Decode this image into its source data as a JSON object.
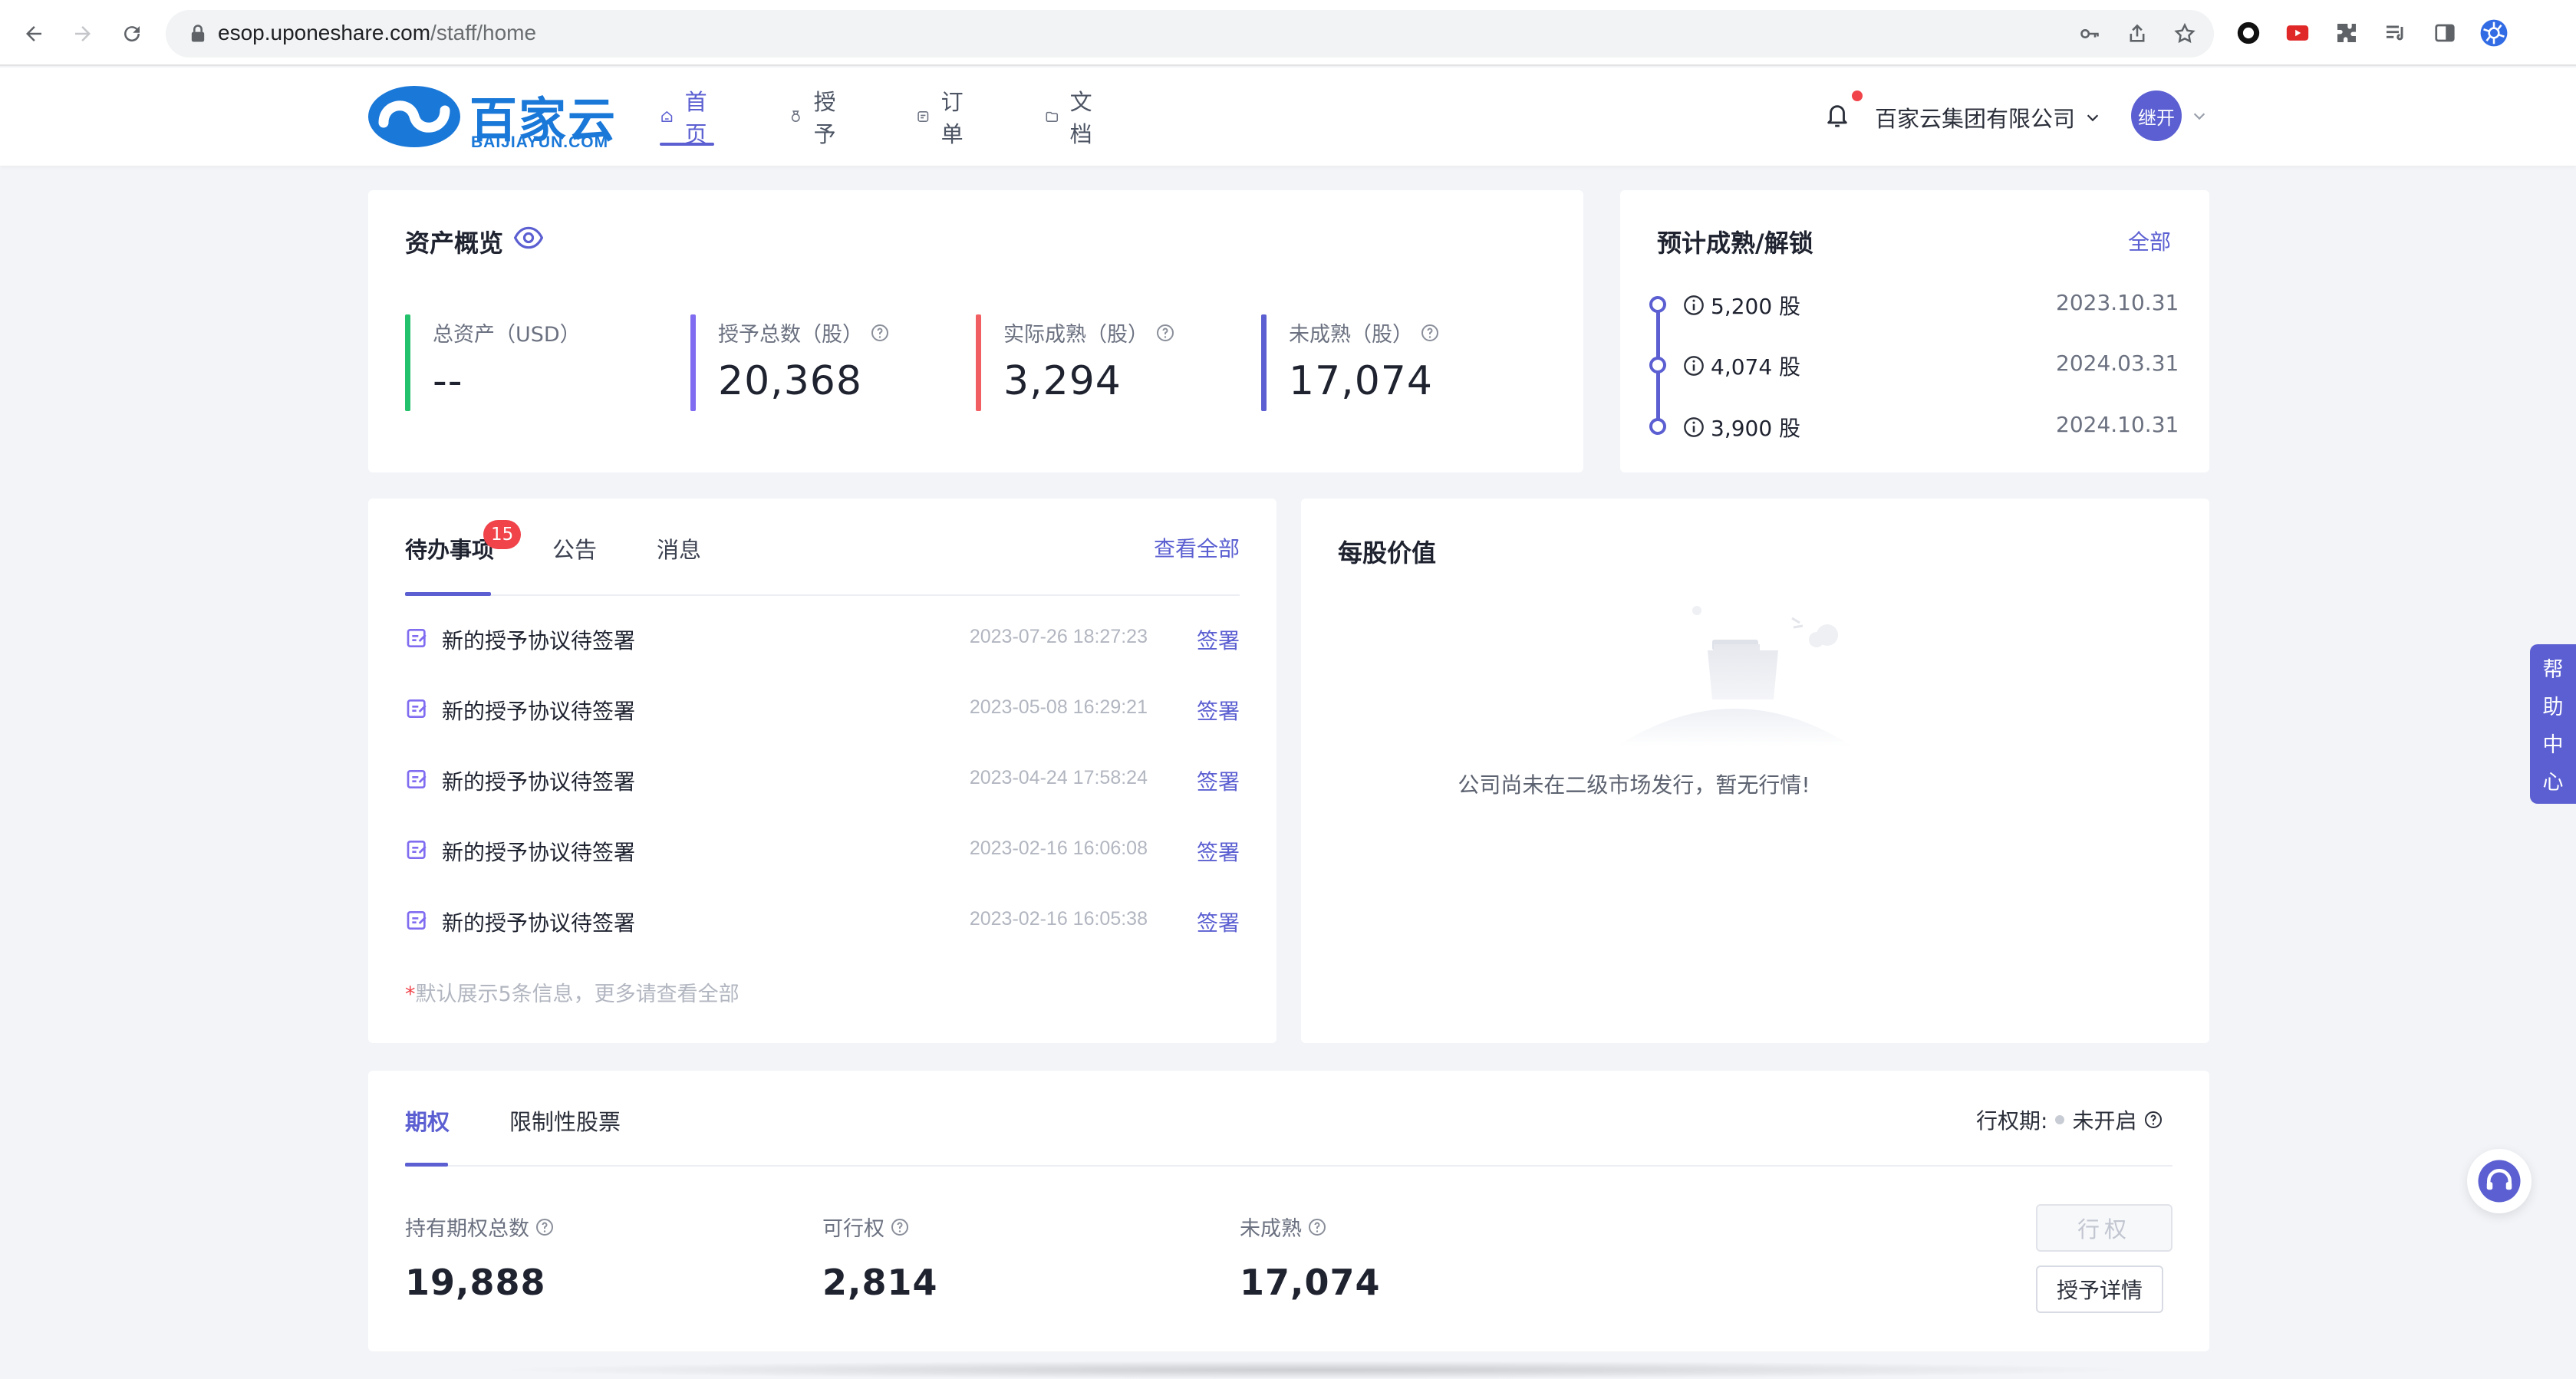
{
  "browser": {
    "url_host": "esop.uponeshare.com",
    "url_path": "/staff/home"
  },
  "header": {
    "logo_text": "百家云",
    "logo_sub": "BAIJIAYUN.COM",
    "nav": [
      {
        "label": "首页",
        "icon": "home-icon",
        "active": true
      },
      {
        "label": "授予",
        "icon": "medal-icon",
        "active": false
      },
      {
        "label": "订单",
        "icon": "order-icon",
        "active": false
      },
      {
        "label": "文档",
        "icon": "folder-icon",
        "active": false
      }
    ],
    "company": "百家云集团有限公司",
    "avatar_text": "继开"
  },
  "overview": {
    "title": "资产概览",
    "stats": [
      {
        "label": "总资产（USD）",
        "value": "--",
        "color": "#23c16b",
        "help": false
      },
      {
        "label": "授予总数（股）",
        "value": "20,368",
        "color": "#7f6cf0",
        "help": true
      },
      {
        "label": "实际成熟（股）",
        "value": "3,294",
        "color": "#f15f63",
        "help": true
      },
      {
        "label": "未成熟（股）",
        "value": "17,074",
        "color": "#5b5fd1",
        "help": true
      }
    ]
  },
  "vesting": {
    "title": "预计成熟/解锁",
    "all_link": "全部",
    "items": [
      {
        "shares": "5,200 股",
        "date": "2023.10.31"
      },
      {
        "shares": "4,074 股",
        "date": "2024.03.31"
      },
      {
        "shares": "3,900 股",
        "date": "2024.10.31"
      }
    ]
  },
  "todo": {
    "tabs": [
      "待办事项",
      "公告",
      "消息"
    ],
    "badge": "15",
    "view_all": "查看全部",
    "rows": [
      {
        "text": "新的授予协议待签署",
        "time": "2023-07-26 18:27:23",
        "action": "签署"
      },
      {
        "text": "新的授予协议待签署",
        "time": "2023-05-08 16:29:21",
        "action": "签署"
      },
      {
        "text": "新的授予协议待签署",
        "time": "2023-04-24 17:58:24",
        "action": "签署"
      },
      {
        "text": "新的授予协议待签署",
        "time": "2023-02-16 16:06:08",
        "action": "签署"
      },
      {
        "text": "新的授予协议待签署",
        "time": "2023-02-16 16:05:38",
        "action": "签署"
      }
    ],
    "note_star": "*",
    "note": "默认展示5条信息，更多请查看全部"
  },
  "share_value": {
    "title": "每股价值",
    "empty_message": "公司尚未在二级市场发行，暂无行情!"
  },
  "options": {
    "tabs": [
      "期权",
      "限制性股票"
    ],
    "exercise_period_label": "行权期:",
    "exercise_period_status": "未开启",
    "stats": [
      {
        "label": "持有期权总数",
        "value": "19,888"
      },
      {
        "label": "可行权",
        "value": "2,814"
      },
      {
        "label": "未成熟",
        "value": "17,074"
      }
    ],
    "exercise_button": "行权",
    "detail_button": "授予详情"
  },
  "help": {
    "chars": [
      "帮",
      "助",
      "中",
      "心"
    ]
  },
  "colors": {
    "accent": "#5b5fd1",
    "badge": "#f0434a"
  }
}
